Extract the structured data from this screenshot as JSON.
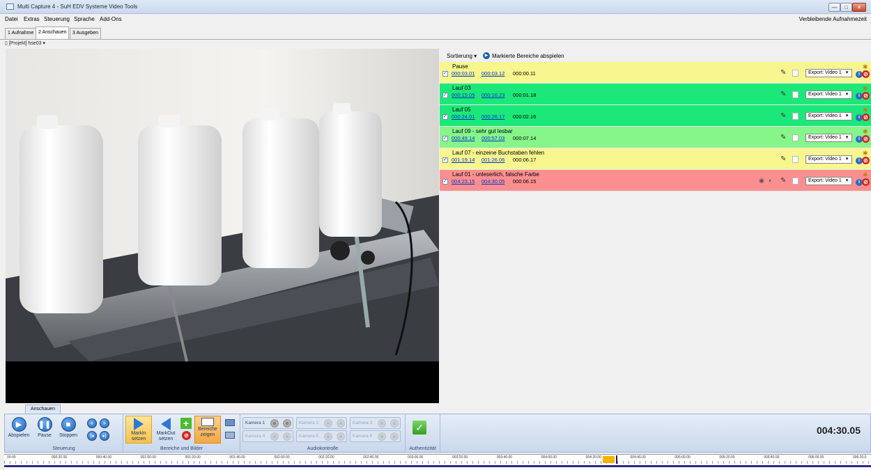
{
  "window": {
    "title": "Multi Capture 4 - SuH EDV Systeme Video Tools",
    "min_glyph": "—",
    "max_glyph": "□",
    "close_glyph": "✕"
  },
  "menu": {
    "items": [
      "Datei",
      "Extras",
      "Steuerung",
      "Sprache",
      "Add-Ons"
    ],
    "right_label": "Verbleibende Aufnahmezeit"
  },
  "tabs": [
    "1 Aufnahme",
    "2 Anschauen",
    "3 Ausgeben"
  ],
  "project": {
    "label": "[Projekt] hse03"
  },
  "segments_toolbar": {
    "sort_label": "Sortierung",
    "play_marked_label": "Markierte Bereiche abspielen"
  },
  "segments": [
    {
      "name": "Pause",
      "in": "000:03.01",
      "out": "000:03.12",
      "duration": "000:00.11",
      "export": "Export: Video 1",
      "color": "#f7f68f",
      "checked": true
    },
    {
      "name": "Lauf 03",
      "in": "000:15.05",
      "out": "000:16.23",
      "duration": "000:01.18",
      "export": "Export: Video 1",
      "color": "#1ce87a",
      "checked": true
    },
    {
      "name": "Lauf 05",
      "in": "000:24.01",
      "out": "000:26.17",
      "duration": "000:02.16",
      "export": "Export: Video 1",
      "color": "#1ce87a",
      "checked": true
    },
    {
      "name": "Lauf 09 - sehr gut lesbar",
      "in": "000:49.14",
      "out": "000:57.03",
      "duration": "000:07.14",
      "export": "Export: Video 1",
      "color": "#86f58a",
      "checked": true
    },
    {
      "name": "Lauf 07 - einzeine Buchstaben fehlen",
      "in": "001:19.14",
      "out": "001:26.06",
      "duration": "000:06.17",
      "export": "Export: Video 1",
      "color": "#f7f68f",
      "checked": true
    },
    {
      "name": "Lauf  01 - unleserlich, falsche Farbe",
      "in": "004:23.15",
      "out": "004:30.05",
      "duration": "000:06.15",
      "export": "Export: Video 1",
      "color": "#fb8f8f",
      "checked": true
    }
  ],
  "ribbon": {
    "tab": "Anschauen",
    "steuerung": {
      "play": "Abspielen",
      "pause": "Pause",
      "stop": "Stoppen",
      "group": "Steuerung"
    },
    "bereiche": {
      "markin_1": "MarkIn",
      "markin_2": "setzen",
      "markout_1": "MarkOut",
      "markout_2": "setzen",
      "show_1": "Bereiche",
      "show_2": "zeigen",
      "group": "Bereiche und Bilder"
    },
    "audio": {
      "cams": [
        "Kamera 1",
        "Kamera 2",
        "Kamera 3",
        "Kamera 4",
        "Kamera 5",
        "Kamera 6"
      ],
      "group": "Audiokontrolle"
    },
    "auth": {
      "group": "Authentizität"
    },
    "time": "004:30.05"
  },
  "timeline": {
    "labels": [
      "00:00",
      "000:20.00",
      "000:40.00",
      "001:00.00",
      "001:20.00",
      "001:40.00",
      "002:00.00",
      "002:20.00",
      "002:40.00",
      "003:00.00",
      "003:20.00",
      "003:40.00",
      "004:00.00",
      "004:20.00",
      "004:40.00",
      "005:00.00",
      "005:20.00",
      "005:40.00",
      "006:00.00",
      "006:20.0"
    ]
  },
  "colors": {
    "accent": "#1f5fb0",
    "timeline_marker": "#f5b400"
  },
  "icons": [
    "app-icon",
    "checkbox-icon",
    "pen-icon",
    "gear-icon",
    "info-icon",
    "delete-icon",
    "play-icon",
    "pause-icon",
    "stop-icon",
    "rewind-icon",
    "forward-icon",
    "markin-icon",
    "markout-icon",
    "add-icon",
    "camera-icon",
    "check-icon"
  ]
}
